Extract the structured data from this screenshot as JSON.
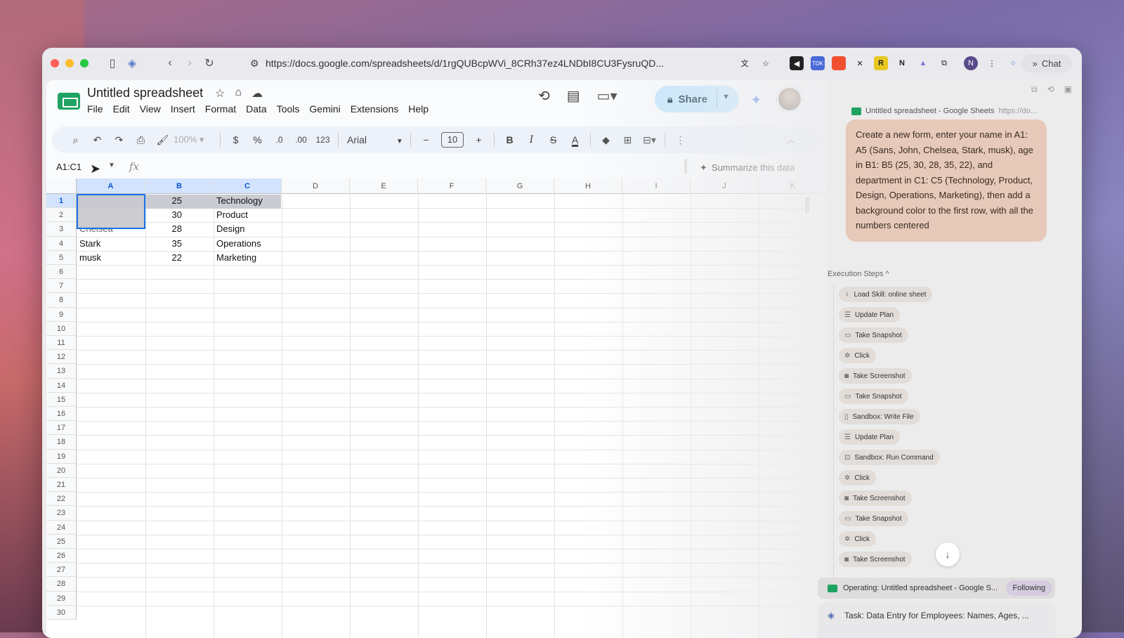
{
  "browser": {
    "url": "https://docs.google.com/spreadsheets/d/1rgQUBcpWVi_8CRh37ez4LNDbI8CU3FysruQD...",
    "chat_label": "Chat"
  },
  "sheets": {
    "title": "Untitled spreadsheet",
    "menu": [
      "File",
      "Edit",
      "View",
      "Insert",
      "Format",
      "Data",
      "Tools",
      "Gemini",
      "Extensions",
      "Help"
    ],
    "share_label": "Share",
    "toolbar": {
      "zoom": "100%",
      "currency": "$",
      "percent": "%",
      "dec_decrease": ".0",
      "dec_increase": ".00",
      "number_format": "123",
      "font": "Arial",
      "font_size": "10"
    },
    "name_box": "A1:C1",
    "fx": "fx",
    "summarize": "Summarize this data",
    "columns": [
      "A",
      "B",
      "C",
      "D",
      "E",
      "F",
      "G",
      "H",
      "I",
      "J",
      "K"
    ],
    "rows": [
      "1",
      "2",
      "3",
      "4",
      "5",
      "6",
      "7",
      "8",
      "9",
      "10",
      "11",
      "12",
      "13",
      "14",
      "15",
      "16",
      "17",
      "18",
      "19",
      "20",
      "21",
      "22",
      "23",
      "24",
      "25",
      "26",
      "27",
      "28",
      "29",
      "30"
    ],
    "cells": {
      "A3": "Chelsea",
      "A4": "Stark",
      "A5": "musk",
      "B1": "25",
      "B2": "30",
      "B3": "28",
      "B4": "35",
      "B5": "22",
      "C1": "Technology",
      "C2": "Product",
      "C3": "Design",
      "C4": "Operations",
      "C5": "Marketing"
    }
  },
  "panel": {
    "tab_title": "Untitled spreadsheet - Google Sheets",
    "tab_url": "https://do...",
    "prompt": "Create a new form, enter your name in A1: A5   (Sans, John, Chelsea, Stark, musk), age in B1: B5 (25, 30, 28, 35, 22), and department in C1: C5 (Technology, Product, Design, Operations, Marketing), then add a background color to the first row, with all the numbers centered",
    "exec_title": "Execution Steps ^",
    "steps": [
      {
        "label": "Load Skill: online sheet",
        "icon": "bulb-icon"
      },
      {
        "label": "Update Plan",
        "icon": "list-icon"
      },
      {
        "label": "Take Snapshot",
        "icon": "window-icon"
      },
      {
        "label": "Click",
        "icon": "pointer-icon"
      },
      {
        "label": "Take Screenshot",
        "icon": "camera-icon"
      },
      {
        "label": "Take Snapshot",
        "icon": "window-icon"
      },
      {
        "label": "Sandbox: Write File",
        "icon": "file-icon"
      },
      {
        "label": "Update Plan",
        "icon": "list-icon"
      },
      {
        "label": "Sandbox: Run Command",
        "icon": "terminal-icon"
      },
      {
        "label": "Click",
        "icon": "pointer-icon"
      },
      {
        "label": "Take Screenshot",
        "icon": "camera-icon"
      },
      {
        "label": "Take Snapshot",
        "icon": "window-icon"
      },
      {
        "label": "Click",
        "icon": "pointer-icon"
      },
      {
        "label": "Take Screenshot",
        "icon": "camera-icon"
      }
    ],
    "operating": "Operating: Untitled spreadsheet - Google S...",
    "following": "Following",
    "task": "Task:  Data Entry for Employees: Names, Ages, ..."
  }
}
